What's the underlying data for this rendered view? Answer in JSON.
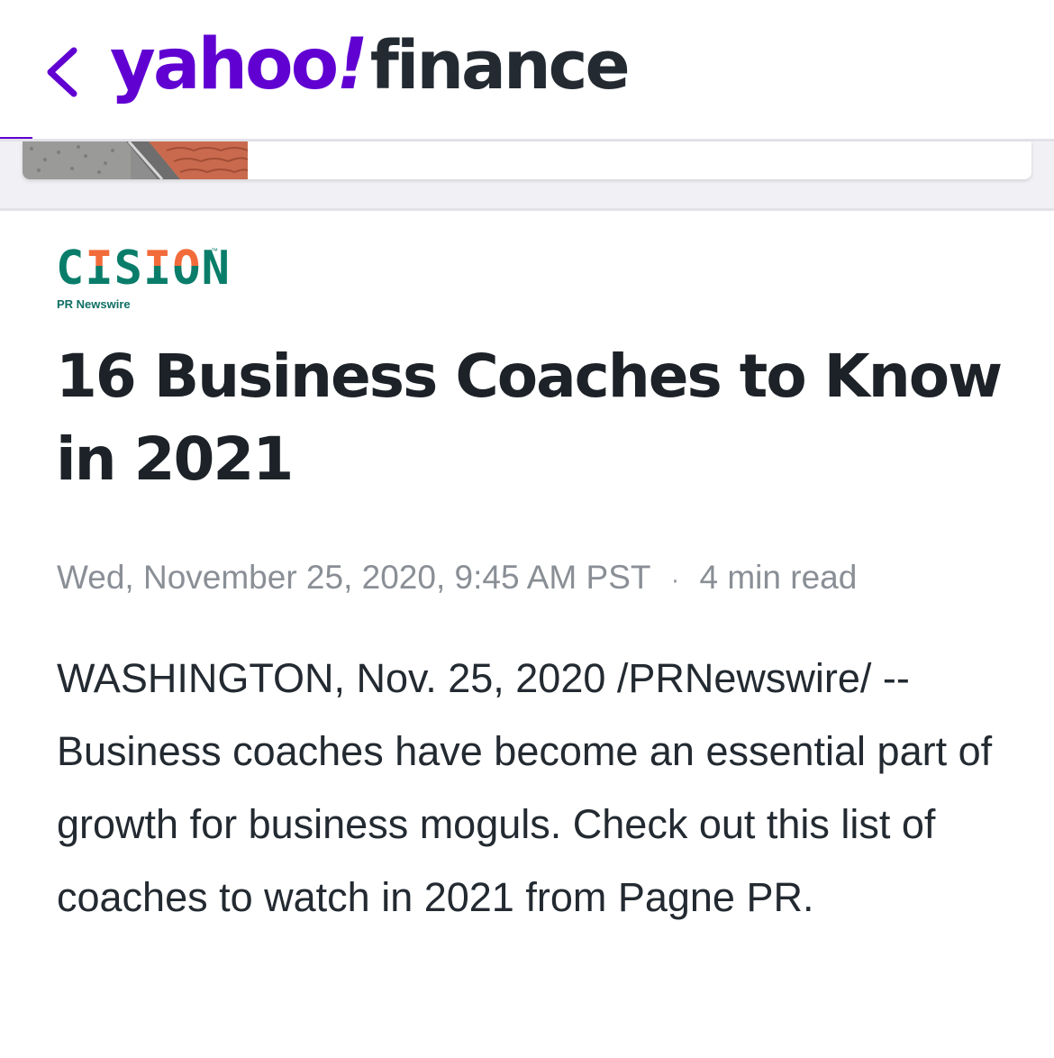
{
  "header": {
    "back_label": "<",
    "logo_main": "yahoo",
    "logo_bang": "!",
    "logo_product": "finance"
  },
  "colors": {
    "brand_purple": "#6001d2",
    "finance_text": "#232a31",
    "cision_teal": "#0a7d6a",
    "cision_orange": "#f26b3a",
    "title_text": "#1d2228",
    "meta_text": "#8a8f96",
    "body_text": "#232a31"
  },
  "icons": {
    "back": "chevron-left-icon"
  },
  "source": {
    "name": "CISION",
    "tagline": "PR Newswire",
    "trademark": "™"
  },
  "article": {
    "title": "16 Business Coaches to Know in 2021",
    "date": "Wed, November 25, 2020, 9:45 AM PST",
    "separator": "·",
    "read_time": "4 min read",
    "body": "WASHINGTON, Nov. 25, 2020 /PRNewswire/ -- Business coaches have become an essential part of growth for business moguls. Check out this list of coaches to watch in 2021 from Pagne PR."
  }
}
